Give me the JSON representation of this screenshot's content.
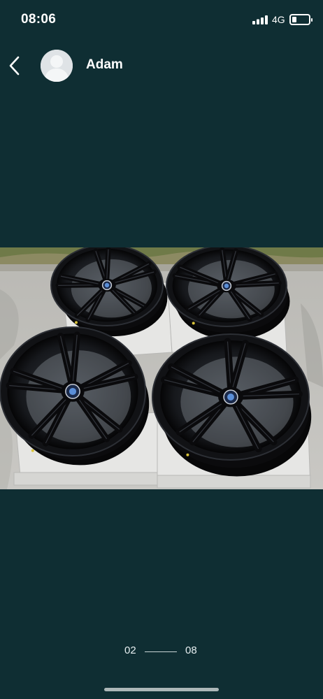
{
  "status_bar": {
    "time": "08:06",
    "network": "4G",
    "signal_icon": "cellular-signal-icon",
    "battery_icon": "battery-icon",
    "battery_level": 0.25
  },
  "header": {
    "back_icon": "chevron-left-icon",
    "avatar_icon": "default-avatar-icon",
    "user_name": "Adam"
  },
  "photo": {
    "subject": "four black alloy wheels on cardboard boxes"
  },
  "pager": {
    "current": "02",
    "total": "08"
  },
  "colors": {
    "background": "#0f2e33",
    "text": "#ffffff",
    "wheel": "#0c0c0e"
  }
}
